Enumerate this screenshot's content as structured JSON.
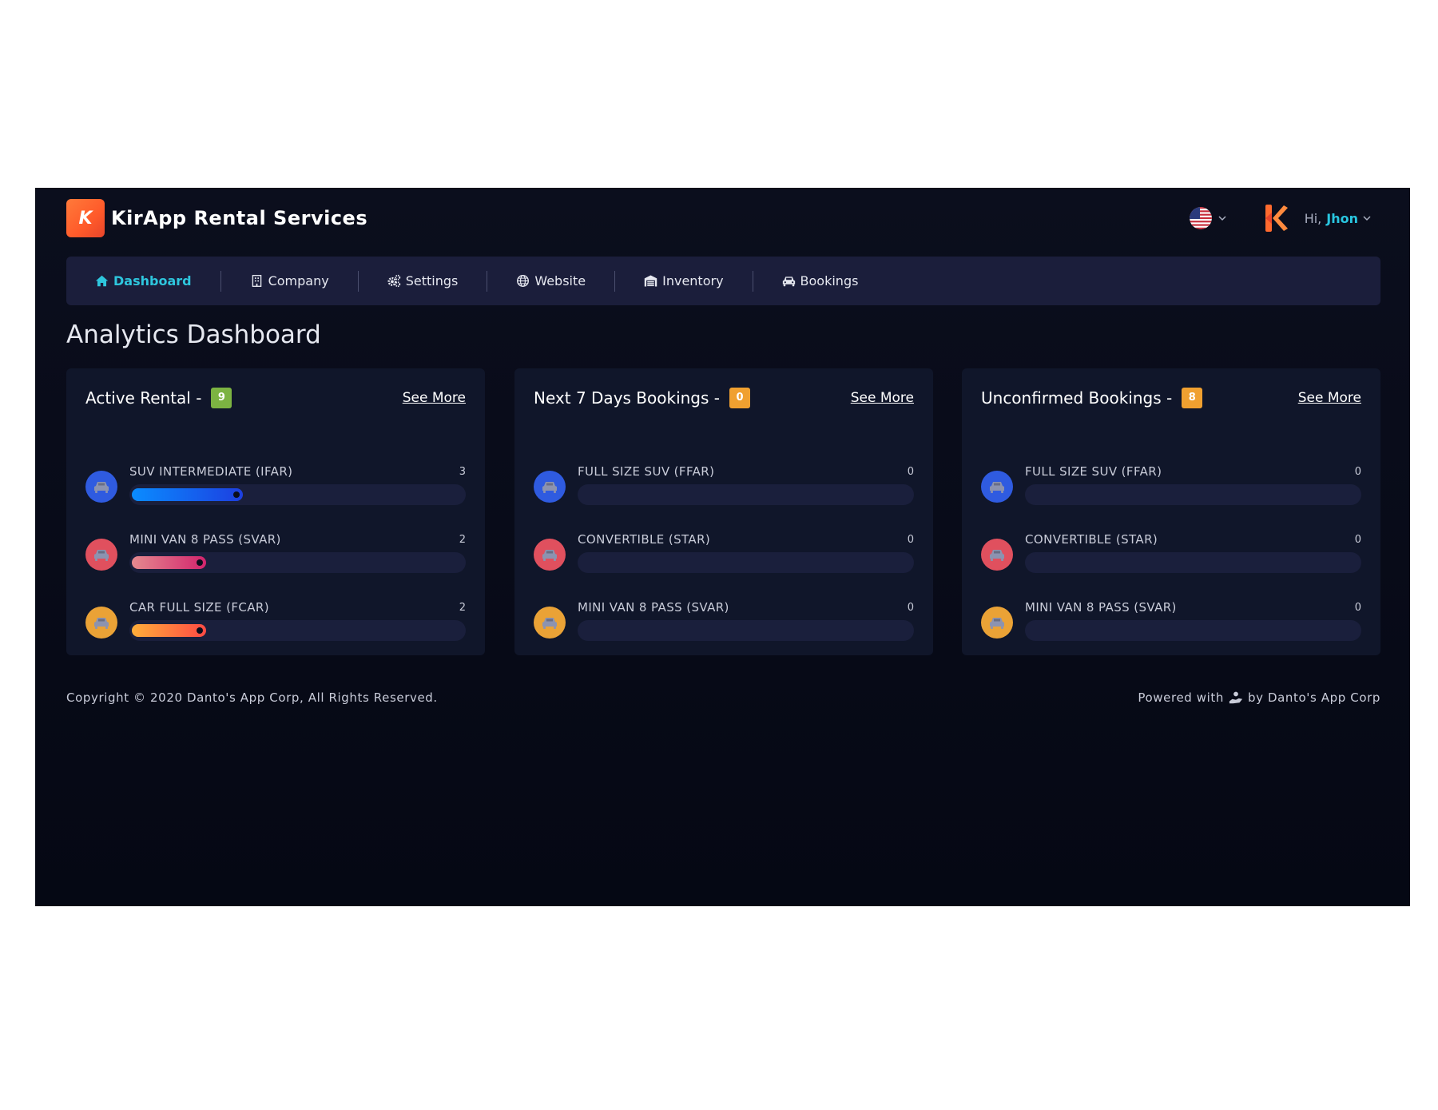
{
  "header": {
    "brand_letter": "K",
    "brand_name": "KirApp Rental Services",
    "greeting": "Hi,",
    "username": "Jhon"
  },
  "nav": [
    {
      "label": "Dashboard",
      "icon": "home-icon",
      "active": true
    },
    {
      "label": "Company",
      "icon": "building-icon",
      "active": false
    },
    {
      "label": "Settings",
      "icon": "gears-icon",
      "active": false
    },
    {
      "label": "Website",
      "icon": "globe-icon",
      "active": false
    },
    {
      "label": "Inventory",
      "icon": "warehouse-icon",
      "active": false
    },
    {
      "label": "Bookings",
      "icon": "car-icon",
      "active": false
    }
  ],
  "page_title": "Analytics Dashboard",
  "cards": [
    {
      "title": "Active Rental -",
      "count": "9",
      "badge_color": "#7cb342",
      "see_more": "See More",
      "rows": [
        {
          "label": "SUV INTERMEDIATE (IFAR)",
          "value": "3",
          "fraction": 0.33,
          "color": "blue"
        },
        {
          "label": "MINI VAN 8 PASS (SVAR)",
          "value": "2",
          "fraction": 0.22,
          "color": "red"
        },
        {
          "label": "CAR FULL SIZE (FCAR)",
          "value": "2",
          "fraction": 0.22,
          "color": "orange"
        }
      ]
    },
    {
      "title": "Next 7 Days Bookings -",
      "count": "0",
      "badge_color": "#f0a030",
      "see_more": "See More",
      "rows": [
        {
          "label": "FULL SIZE SUV (FFAR)",
          "value": "0",
          "fraction": 0,
          "color": "blue"
        },
        {
          "label": "CONVERTIBLE (STAR)",
          "value": "0",
          "fraction": 0,
          "color": "red"
        },
        {
          "label": "MINI VAN 8 PASS (SVAR)",
          "value": "0",
          "fraction": 0,
          "color": "orange"
        }
      ]
    },
    {
      "title": "Unconfirmed Bookings -",
      "count": "8",
      "badge_color": "#f0a030",
      "see_more": "See More",
      "rows": [
        {
          "label": "FULL SIZE SUV (FFAR)",
          "value": "0",
          "fraction": 0,
          "color": "blue"
        },
        {
          "label": "CONVERTIBLE (STAR)",
          "value": "0",
          "fraction": 0,
          "color": "red"
        },
        {
          "label": "MINI VAN 8 PASS (SVAR)",
          "value": "0",
          "fraction": 0,
          "color": "orange"
        }
      ]
    }
  ],
  "footer": {
    "copyright": "Copyright © 2020 Danto's App Corp, All Rights Reserved.",
    "powered_prefix": "Powered with",
    "powered_suffix": "by Danto's App Corp"
  },
  "colors": {
    "blue": "#2f5be0",
    "red": "#e0505e",
    "orange": "#eaa236",
    "accent": "#2ec6dd"
  }
}
